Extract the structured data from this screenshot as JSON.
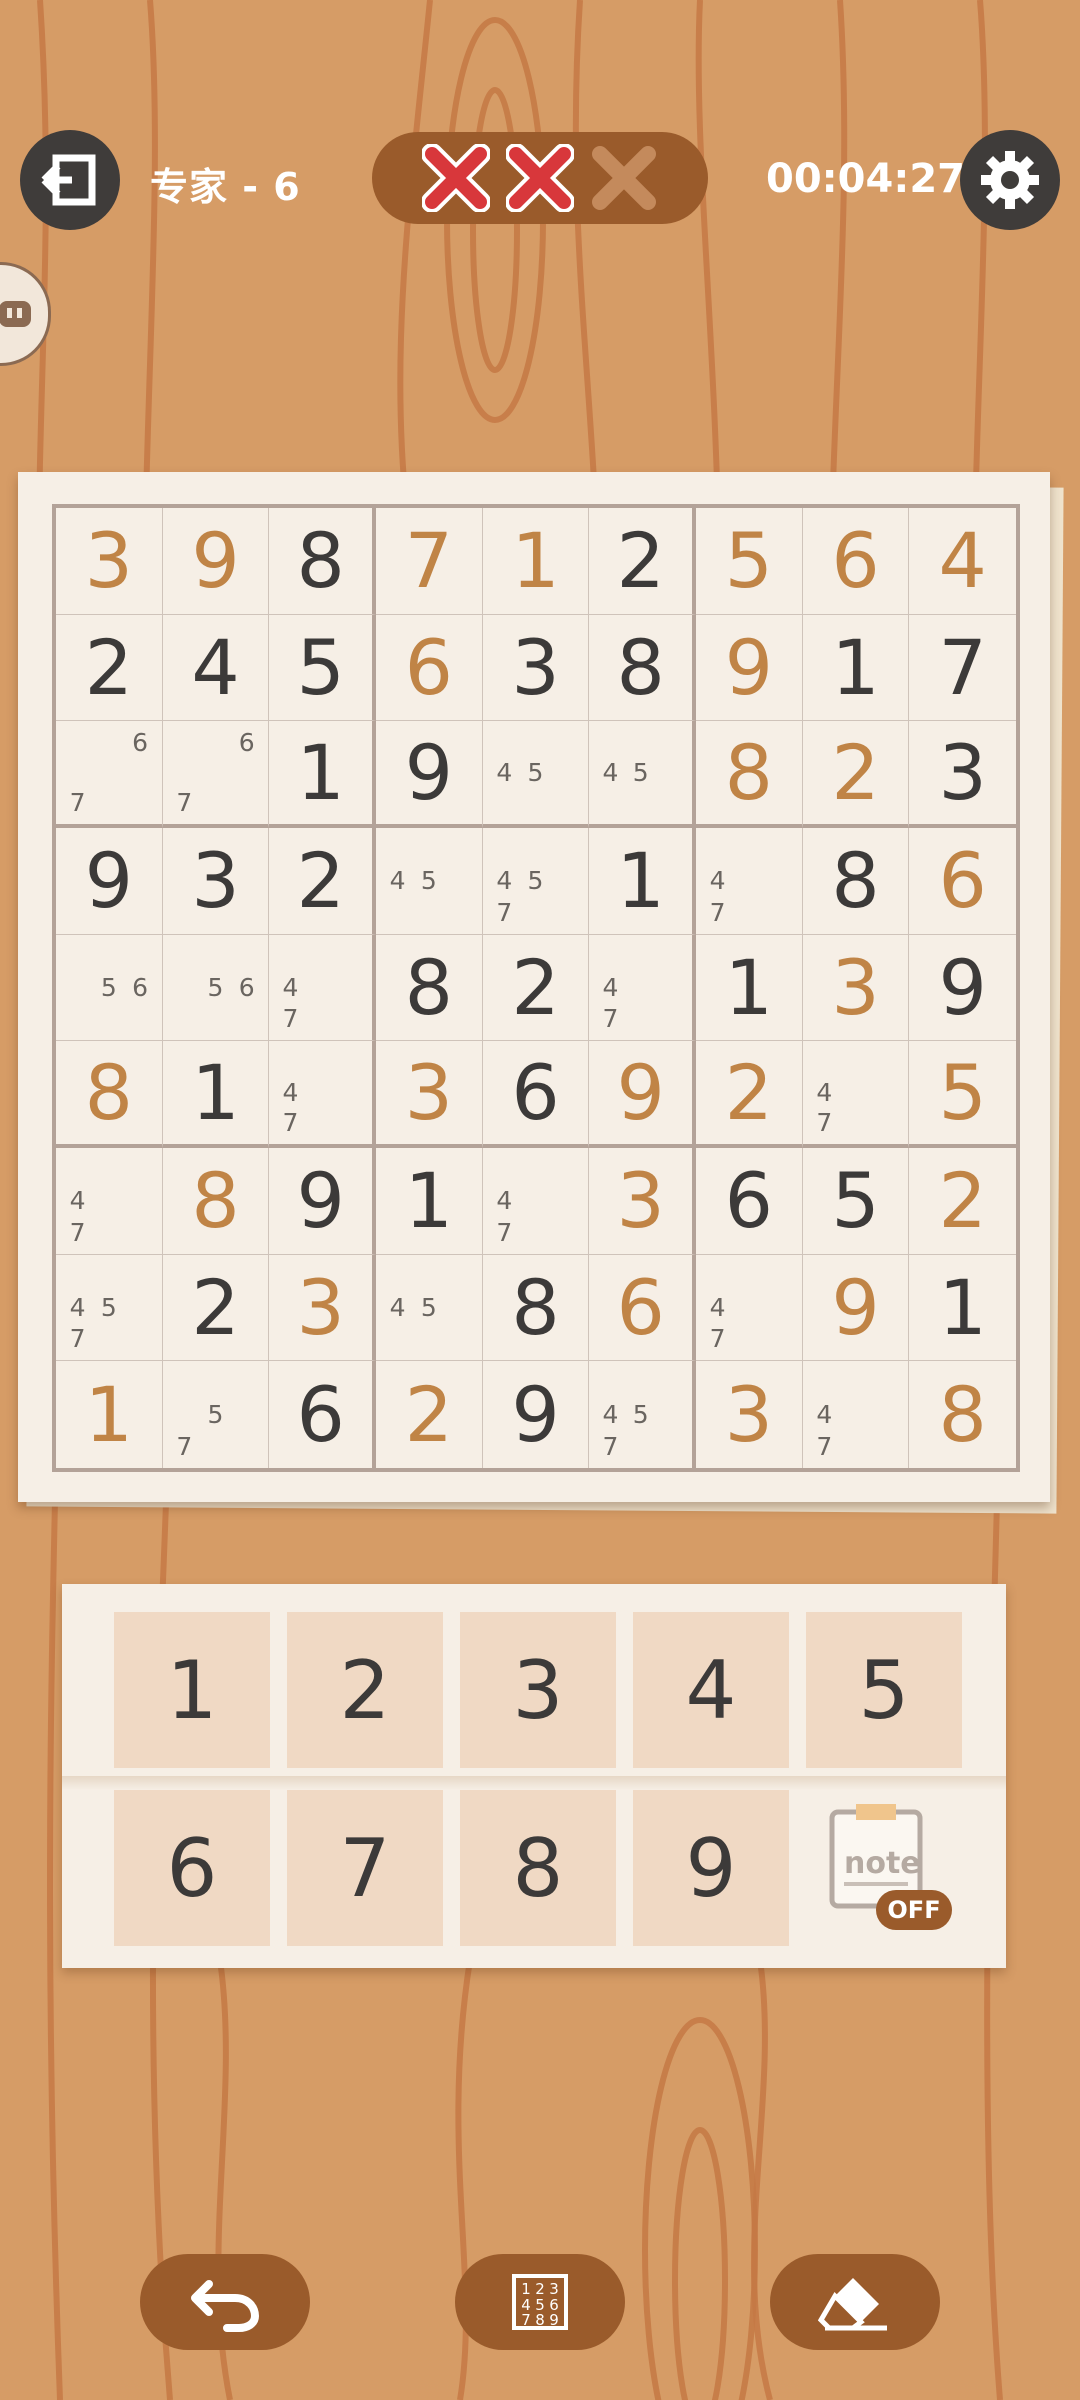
{
  "header": {
    "title": "专家 - 6",
    "timer": "00:04:27",
    "mistakes": [
      {
        "state": "made",
        "color": "#d8373b"
      },
      {
        "state": "made",
        "color": "#d8373b"
      },
      {
        "state": "remaining",
        "color": "#c48a5c"
      }
    ]
  },
  "board": {
    "rows": [
      [
        {
          "v": "3",
          "t": "entered"
        },
        {
          "v": "9",
          "t": "entered"
        },
        {
          "v": "8",
          "t": "given"
        },
        {
          "v": "7",
          "t": "entered"
        },
        {
          "v": "1",
          "t": "entered"
        },
        {
          "v": "2",
          "t": "given"
        },
        {
          "v": "5",
          "t": "entered"
        },
        {
          "v": "6",
          "t": "entered"
        },
        {
          "v": "4",
          "t": "entered"
        }
      ],
      [
        {
          "v": "2",
          "t": "given"
        },
        {
          "v": "4",
          "t": "given"
        },
        {
          "v": "5",
          "t": "given"
        },
        {
          "v": "6",
          "t": "entered"
        },
        {
          "v": "3",
          "t": "given"
        },
        {
          "v": "8",
          "t": "given"
        },
        {
          "v": "9",
          "t": "entered"
        },
        {
          "v": "1",
          "t": "given"
        },
        {
          "v": "7",
          "t": "given"
        }
      ],
      [
        {
          "notes": [
            "",
            "",
            "6",
            "",
            "",
            "",
            "7",
            "",
            ""
          ]
        },
        {
          "notes": [
            "",
            "",
            "6",
            "",
            "",
            "",
            "7",
            "",
            ""
          ]
        },
        {
          "v": "1",
          "t": "given"
        },
        {
          "v": "9",
          "t": "given"
        },
        {
          "notes": [
            "",
            "",
            "",
            "4",
            "5",
            "",
            "",
            "",
            ""
          ]
        },
        {
          "notes": [
            "",
            "",
            "",
            "4",
            "5",
            "",
            "",
            "",
            ""
          ]
        },
        {
          "v": "8",
          "t": "entered"
        },
        {
          "v": "2",
          "t": "entered"
        },
        {
          "v": "3",
          "t": "given"
        }
      ],
      [
        {
          "v": "9",
          "t": "given"
        },
        {
          "v": "3",
          "t": "given"
        },
        {
          "v": "2",
          "t": "given"
        },
        {
          "notes": [
            "",
            "",
            "",
            "4",
            "5",
            "",
            "",
            "",
            ""
          ]
        },
        {
          "notes": [
            "",
            "",
            "",
            "4",
            "5",
            "",
            "7",
            "",
            ""
          ]
        },
        {
          "v": "1",
          "t": "given"
        },
        {
          "notes": [
            "",
            "",
            "",
            "4",
            "",
            "",
            "7",
            "",
            ""
          ]
        },
        {
          "v": "8",
          "t": "given"
        },
        {
          "v": "6",
          "t": "entered"
        }
      ],
      [
        {
          "notes": [
            "",
            "",
            "",
            "",
            "5",
            "6",
            "",
            "",
            ""
          ]
        },
        {
          "notes": [
            "",
            "",
            "",
            "",
            "5",
            "6",
            "",
            "",
            ""
          ]
        },
        {
          "notes": [
            "",
            "",
            "",
            "4",
            "",
            "",
            "7",
            "",
            ""
          ]
        },
        {
          "v": "8",
          "t": "given"
        },
        {
          "v": "2",
          "t": "given"
        },
        {
          "notes": [
            "",
            "",
            "",
            "4",
            "",
            "",
            "7",
            "",
            ""
          ]
        },
        {
          "v": "1",
          "t": "given"
        },
        {
          "v": "3",
          "t": "entered"
        },
        {
          "v": "9",
          "t": "given"
        }
      ],
      [
        {
          "v": "8",
          "t": "entered"
        },
        {
          "v": "1",
          "t": "given"
        },
        {
          "notes": [
            "",
            "",
            "",
            "4",
            "",
            "",
            "7",
            "",
            ""
          ]
        },
        {
          "v": "3",
          "t": "entered"
        },
        {
          "v": "6",
          "t": "given"
        },
        {
          "v": "9",
          "t": "entered"
        },
        {
          "v": "2",
          "t": "entered"
        },
        {
          "notes": [
            "",
            "",
            "",
            "4",
            "",
            "",
            "7",
            "",
            ""
          ]
        },
        {
          "v": "5",
          "t": "entered"
        }
      ],
      [
        {
          "notes": [
            "",
            "",
            "",
            "4",
            "",
            "",
            "7",
            "",
            ""
          ]
        },
        {
          "v": "8",
          "t": "entered"
        },
        {
          "v": "9",
          "t": "given"
        },
        {
          "v": "1",
          "t": "given"
        },
        {
          "notes": [
            "",
            "",
            "",
            "4",
            "",
            "",
            "7",
            "",
            ""
          ]
        },
        {
          "v": "3",
          "t": "entered"
        },
        {
          "v": "6",
          "t": "given"
        },
        {
          "v": "5",
          "t": "given"
        },
        {
          "v": "2",
          "t": "entered"
        }
      ],
      [
        {
          "notes": [
            "",
            "",
            "",
            "4",
            "5",
            "",
            "7",
            "",
            ""
          ]
        },
        {
          "v": "2",
          "t": "given"
        },
        {
          "v": "3",
          "t": "entered"
        },
        {
          "notes": [
            "",
            "",
            "",
            "4",
            "5",
            "",
            "",
            "",
            ""
          ]
        },
        {
          "v": "8",
          "t": "given"
        },
        {
          "v": "6",
          "t": "entered"
        },
        {
          "notes": [
            "",
            "",
            "",
            "4",
            "",
            "",
            "7",
            "",
            ""
          ]
        },
        {
          "v": "9",
          "t": "entered"
        },
        {
          "v": "1",
          "t": "given"
        }
      ],
      [
        {
          "v": "1",
          "t": "entered"
        },
        {
          "notes": [
            "",
            "",
            "",
            "",
            "5",
            "",
            "7",
            "",
            ""
          ]
        },
        {
          "v": "6",
          "t": "given"
        },
        {
          "v": "2",
          "t": "entered"
        },
        {
          "v": "9",
          "t": "given"
        },
        {
          "notes": [
            "",
            "",
            "",
            "4",
            "5",
            "",
            "7",
            "",
            ""
          ]
        },
        {
          "v": "3",
          "t": "entered"
        },
        {
          "notes": [
            "",
            "",
            "",
            "4",
            "",
            "",
            "7",
            "",
            ""
          ]
        },
        {
          "v": "8",
          "t": "entered"
        }
      ]
    ]
  },
  "pad": {
    "keys": [
      "1",
      "2",
      "3",
      "4",
      "5",
      "6",
      "7",
      "8",
      "9"
    ],
    "note_label": "note",
    "note_state": "OFF"
  },
  "icons": {
    "exit": "exit-icon",
    "settings": "gear-icon",
    "undo": "undo-icon",
    "numbers": "number-grid-icon",
    "erase": "eraser-icon"
  },
  "colors": {
    "given": "#3c3a39",
    "entered": "#c08446",
    "wood": "#d69c66",
    "accent": "#9a5b2b"
  }
}
